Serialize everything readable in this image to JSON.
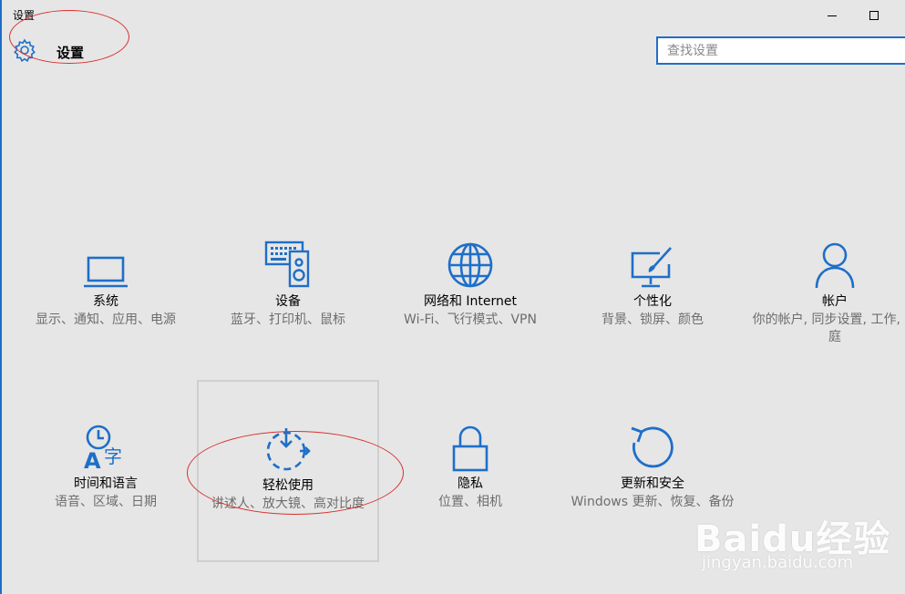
{
  "window": {
    "title": "设置"
  },
  "header": {
    "title": "设置"
  },
  "search": {
    "placeholder": "查找设置"
  },
  "tiles": [
    {
      "label": "系统",
      "desc": "显示、通知、应用、电源",
      "icon": "laptop-icon"
    },
    {
      "label": "设备",
      "desc": "蓝牙、打印机、鼠标",
      "icon": "keyboard-speaker-icon"
    },
    {
      "label": "网络和 Internet",
      "desc": "Wi-Fi、飞行模式、VPN",
      "icon": "globe-icon"
    },
    {
      "label": "个性化",
      "desc": "背景、锁屏、颜色",
      "icon": "paint-monitor-icon"
    },
    {
      "label": "帐户",
      "desc": "你的帐户, 同步设置, 工作, 家庭",
      "icon": "person-icon"
    },
    {
      "label": "时间和语言",
      "desc": "语音、区域、日期",
      "icon": "time-language-icon"
    },
    {
      "label": "轻松使用",
      "desc": "讲述人、放大镜、高对比度",
      "icon": "ease-of-access-icon"
    },
    {
      "label": "隐私",
      "desc": "位置、相机",
      "icon": "lock-icon"
    },
    {
      "label": "更新和安全",
      "desc": "Windows 更新、恢复、备份",
      "icon": "refresh-icon"
    }
  ],
  "watermark": {
    "brand": "Baidu经验",
    "url": "jingyan.baidu.com"
  },
  "colors": {
    "accent": "#1e6fc8",
    "background": "#e6e6e6",
    "annotation": "#d93030"
  }
}
